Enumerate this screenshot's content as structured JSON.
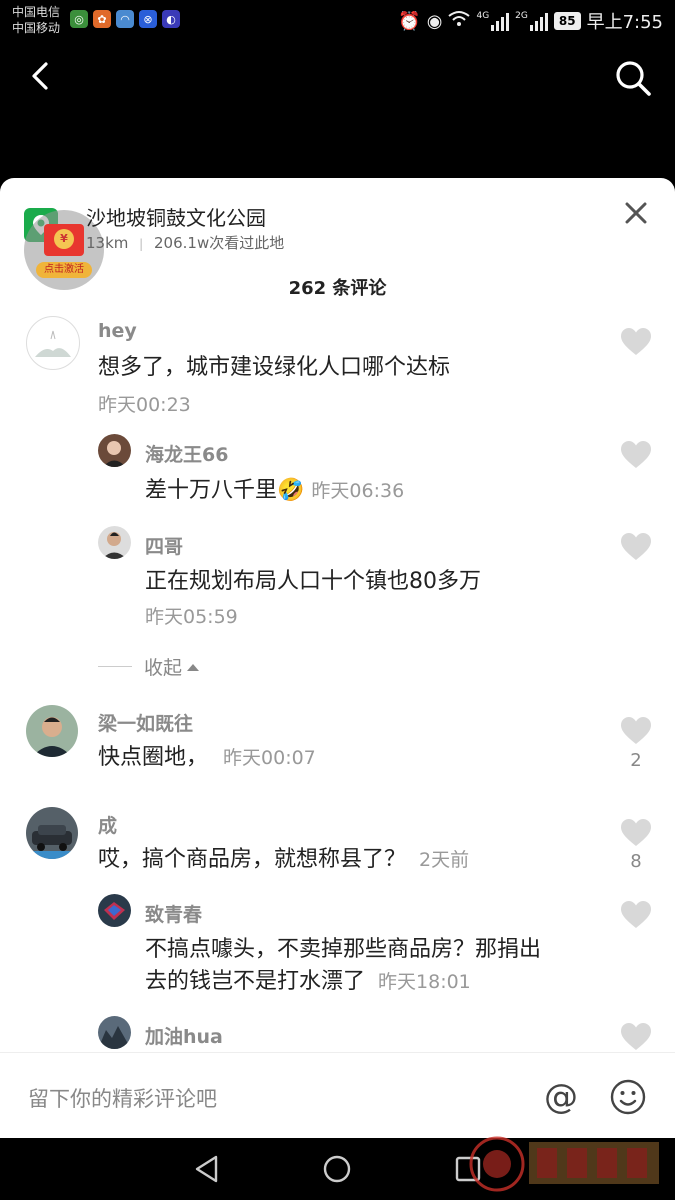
{
  "status_bar": {
    "carrier1": "中国电信",
    "carrier2": "中国移动",
    "net1": "4G",
    "net2": "2G",
    "battery": "85",
    "time": "早上7:55"
  },
  "poi": {
    "name": "沙地坡铜鼓文化公园",
    "distance": "13km",
    "separator": "|",
    "visits": "206.1w次看过此地",
    "red_packet_label": "点击激活",
    "red_packet_coin": "¥"
  },
  "comments_title": "262 条评论",
  "comments": [
    {
      "user": "hey",
      "text": "想多了，城市建设绿化人口哪个达标",
      "time": "昨天00:23"
    },
    {
      "user": "海龙王66",
      "text": "差十万八千里🤣",
      "time": "昨天06:36"
    },
    {
      "user": "四哥",
      "text": "正在规划布局人口十个镇也80多万",
      "time": "昨天05:59"
    },
    {
      "user": "梁一如既往",
      "text": "快点圈地，",
      "time": "昨天00:07",
      "likes": "2"
    },
    {
      "user": "成",
      "text": "哎，搞个商品房，就想称县了？",
      "time": "2天前",
      "likes": "8"
    },
    {
      "user": "致青春",
      "text_line1": "不搞点噱头，不卖掉那些商品房？那捐出",
      "text_line2": "去的钱岂不是打水漂了",
      "time": "昨天18:01"
    },
    {
      "user": "加油hua"
    }
  ],
  "collapse_label": "收起",
  "input": {
    "placeholder": "留下你的精彩评论吧",
    "at": "@"
  },
  "colors": {
    "accent_green": "#1aab4b",
    "red_packet": "#e8362f",
    "heart": "#d8d8d8"
  }
}
